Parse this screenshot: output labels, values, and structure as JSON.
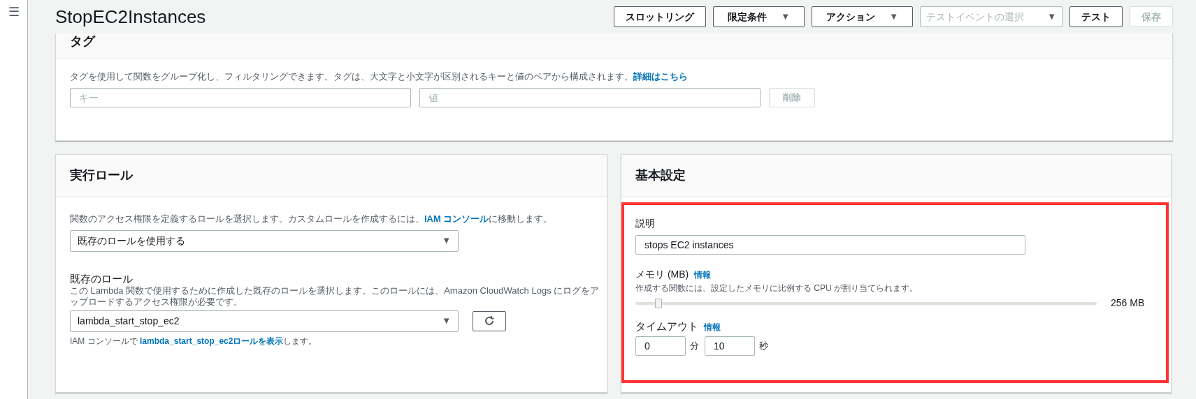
{
  "sidebar": {
    "menu_icon": "☰"
  },
  "header": {
    "title": "StopEC2Instances",
    "buttons": [
      {
        "kind": "button",
        "label": "スロットリング",
        "disabled": false
      },
      {
        "kind": "dropdown",
        "label": "限定条件",
        "caret": "▼",
        "disabled": false
      },
      {
        "kind": "dropdown",
        "label": "アクション",
        "caret": "▼",
        "disabled": false
      },
      {
        "kind": "select",
        "placeholder": "テストイベントの選択",
        "caret": "▼",
        "disabled": false
      },
      {
        "kind": "button",
        "label": "テスト",
        "disabled": false
      },
      {
        "kind": "button",
        "label": "保存",
        "disabled": true
      }
    ]
  },
  "tags_card": {
    "title": "タグ",
    "description": {
      "before": "タグを使用して関数をグループ化し、フィルタリングできます。タグは、大文字と小文字が区別されるキーと値のペアから構成されます。",
      "link": "詳細はこちら"
    },
    "key_field": {
      "placeholder": "キー"
    },
    "value_field": {
      "placeholder": "値"
    },
    "delete_button": {
      "label": "削除",
      "disabled": true
    }
  },
  "role_card": {
    "title": "実行ロール",
    "description": {
      "before": "関数のアクセス権限を定義するロールを選択します。カスタムロールを作成するには、",
      "link": "IAM コンソール",
      "after": "に移動します。"
    },
    "role_select": {
      "value": "既存のロールを使用する",
      "caret": "▼"
    },
    "existing_role": {
      "label": "既存のロール",
      "description": "この Lambda 関数で使用するために作成した既存のロールを選択します。このロールには、Amazon CloudWatch Logs にログをアップロードするアクセス権限が必要です。",
      "select": {
        "value": "lambda_start_stop_ec2",
        "caret": "▼"
      },
      "note": {
        "before": "IAM コンソールで ",
        "link": "lambda_start_stop_ec2ロールを表示",
        "after": "します。"
      }
    }
  },
  "basic_card": {
    "title": "基本設定",
    "highlighted": true,
    "description": {
      "label": "説明",
      "value": "stops EC2 instances"
    },
    "memory": {
      "label": "メモリ (MB)",
      "info": "情報",
      "hint": "作成する関数には、設定したメモリに比例する CPU が割り当てられます。",
      "level": 0.05,
      "reading": "256 MB"
    },
    "timeout": {
      "label": "タイムアウト",
      "info": "情報",
      "minutes": "0",
      "minutes_unit": "分",
      "seconds": "10",
      "seconds_unit": "秒"
    }
  }
}
